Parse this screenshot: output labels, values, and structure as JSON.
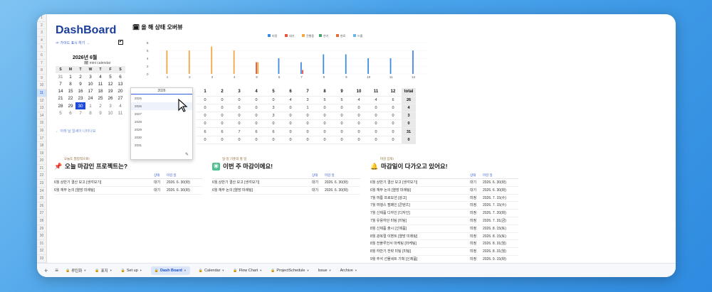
{
  "dashboard": {
    "title": "DashBoard",
    "guide_label": "☞ 가이드 표시 하기 →",
    "guide_checked": "✔"
  },
  "calendar": {
    "month_title": "2026년 6월",
    "mini_label": "🗓 mini calendar",
    "weekday_headers": [
      "S",
      "M",
      "T",
      "W",
      "T",
      "F",
      "S"
    ],
    "weeks": [
      [
        "31",
        "1",
        "2",
        "3",
        "4",
        "5",
        "6"
      ],
      [
        "7",
        "8",
        "9",
        "10",
        "11",
        "12",
        "13"
      ],
      [
        "14",
        "15",
        "16",
        "17",
        "18",
        "19",
        "20"
      ],
      [
        "21",
        "22",
        "23",
        "24",
        "25",
        "26",
        "27"
      ],
      [
        "28",
        "29",
        "30",
        "1",
        "2",
        "3",
        "4"
      ],
      [
        "5",
        "6",
        "7",
        "8",
        "9",
        "10",
        "11"
      ]
    ],
    "today": "30",
    "note": "← 아래 날 일세이 나타나요"
  },
  "chart_data": {
    "type": "bar",
    "title": "올 해 상태 오버뷰",
    "categories": [
      "1",
      "2",
      "3",
      "4",
      "5",
      "6",
      "7",
      "8",
      "9",
      "10",
      "11",
      "12"
    ],
    "ylim": [
      0,
      8
    ],
    "yticks": [
      "0",
      "2",
      "4",
      "6",
      "8"
    ],
    "legend_position": "top",
    "series": [
      {
        "name": "미정",
        "color": "#3f8be0",
        "values": [
          0,
          0,
          0,
          0,
          0,
          4,
          3,
          5,
          5,
          4,
          4,
          6
        ]
      },
      {
        "name": "대기",
        "color": "#e5553a",
        "values": [
          0,
          0,
          0,
          0,
          3,
          0,
          1,
          0,
          0,
          0,
          0,
          0
        ]
      },
      {
        "name": "진행중",
        "color": "#f2a640",
        "values": [
          6,
          6,
          7,
          6,
          3,
          0,
          0,
          0,
          0,
          0,
          0,
          0
        ]
      },
      {
        "name": "연기",
        "color": "#44a368",
        "values": [
          0,
          0,
          0,
          0,
          0,
          0,
          0,
          0,
          0,
          0,
          0,
          0
        ]
      },
      {
        "name": "완료",
        "color": "#e0703a",
        "values": [
          0,
          0,
          0,
          0,
          0,
          0,
          0,
          0,
          0,
          0,
          0,
          0
        ]
      },
      {
        "name": "드롭",
        "color": "#6bb5e8",
        "values": [
          0,
          0,
          0,
          0,
          0,
          0,
          0,
          0,
          0,
          0,
          0,
          0
        ]
      }
    ]
  },
  "year_table": {
    "selected_year": "2026",
    "year_options": [
      "2025",
      "2026",
      "2027",
      "2028",
      "2029",
      "2030",
      "2031"
    ],
    "months": [
      "1",
      "2",
      "3",
      "4",
      "5",
      "6",
      "7",
      "8",
      "9",
      "10",
      "11",
      "12"
    ],
    "total_label": "total",
    "rows": [
      {
        "values": [
          "0",
          "0",
          "0",
          "0",
          "0",
          "4",
          "3",
          "5",
          "5",
          "4",
          "4",
          "6"
        ],
        "total": "26"
      },
      {
        "values": [
          "0",
          "0",
          "0",
          "0",
          "3",
          "0",
          "1",
          "0",
          "0",
          "0",
          "0",
          "0"
        ],
        "total": "4"
      },
      {
        "values": [
          "0",
          "0",
          "0",
          "0",
          "3",
          "0",
          "0",
          "0",
          "0",
          "0",
          "0",
          "0"
        ],
        "total": "3"
      },
      {
        "values": [
          "0",
          "0",
          "0",
          "0",
          "0",
          "0",
          "0",
          "0",
          "0",
          "0",
          "0",
          "0"
        ],
        "total": "0"
      },
      {
        "values": [
          "6",
          "6",
          "7",
          "6",
          "6",
          "0",
          "0",
          "0",
          "0",
          "0",
          "0",
          "0"
        ],
        "total": "31"
      },
      {
        "values": [
          "0",
          "0",
          "0",
          "0",
          "0",
          "0",
          "0",
          "0",
          "0",
          "0",
          "0",
          "0"
        ],
        "total": "0"
      }
    ]
  },
  "sections": {
    "today": {
      "small": "오늘도 열정적으로!",
      "title": "오늘 마감인 프로젝트는?",
      "col_status": "상태",
      "col_deadline": "마감 일",
      "items": [
        {
          "name": "6월 상반기 결산 보고 [생각보기]",
          "status": "대기",
          "date": "2026. 6. 30(화)"
        },
        {
          "name": "6월 재무 논의 [열망 미례팅]",
          "status": "대기",
          "date": "2026. 6. 30(화)"
        }
      ]
    },
    "week": {
      "small": "일-일 기준의 할 일",
      "title": "이번 주 마감이에요!",
      "col_status": "상태",
      "col_deadline": "마감 일",
      "items": [
        {
          "name": "6월 상반기 결산 보고 [생각보기]",
          "status": "대기",
          "date": "2026. 6. 30(화)"
        },
        {
          "name": "6월 재무 논의 [열망 미례팅]",
          "status": "대기",
          "date": "2026. 6. 30(화)"
        }
      ]
    },
    "upcoming": {
      "small": "마감 임박!",
      "title": "마감일이 다가오고 있어요!",
      "col_status": "상태",
      "col_deadline": "마감 일",
      "items": [
        {
          "name": "6월 상반기 결산 보고 [생각보기]",
          "status": "대기",
          "date": "2026. 6. 30(화)"
        },
        {
          "name": "6월 재무 논의 [열망 미례팅]",
          "status": "대기",
          "date": "2026. 6. 30(화)"
        },
        {
          "name": "7월 여름 프로모션 [광고]",
          "status": "미정",
          "date": "2026. 7. 15(수)"
        },
        {
          "name": "7월 여행스 캠페인 [콘텐츠]",
          "status": "미정",
          "date": "2026. 7. 15(수)"
        },
        {
          "name": "7월 신제품 디자인 [디자인]",
          "status": "미정",
          "date": "2026. 7. 20(화)"
        },
        {
          "name": "7월 유용하던 미팅 [미팅]",
          "status": "미정",
          "date": "2026. 7. 31(금)"
        },
        {
          "name": "8월 신제품 출시 [신제품]",
          "status": "미정",
          "date": "2026. 8. 15(토)"
        },
        {
          "name": "8월 광복절 이벤트 [열망 미례팅]",
          "status": "미정",
          "date": "2026. 8. 15(토)"
        },
        {
          "name": "8월 전플루언서 마케팅 [마케팅]",
          "status": "미정",
          "date": "2026. 8. 31(월)"
        },
        {
          "name": "8월 하반기 전략 미팅 [미팅]",
          "status": "미정",
          "date": "2026. 8. 31(월)"
        },
        {
          "name": "9월 추석 선물세트 기획 [신제품]",
          "status": "미정",
          "date": "2026. 9. 15(화)"
        }
      ]
    }
  },
  "tabs": [
    {
      "label": "루틴화",
      "icon": "🔒",
      "active": false
    },
    {
      "label": "표지",
      "icon": "🔒",
      "active": false
    },
    {
      "label": "Set up",
      "icon": "🔒",
      "active": false
    },
    {
      "label": "Dash Board",
      "icon": "🔒",
      "active": true
    },
    {
      "label": "Calendar",
      "icon": "🔒",
      "active": false
    },
    {
      "label": "Flow Chart",
      "icon": "🔒",
      "active": false
    },
    {
      "label": "ProjectSchedule",
      "icon": "🔒",
      "active": false
    },
    {
      "label": "Issue",
      "icon": "",
      "active": false
    },
    {
      "label": "Archive",
      "icon": "",
      "active": false
    }
  ],
  "row_numbers": [
    "1",
    "2",
    "3",
    "4",
    "5",
    "6",
    "7",
    "8",
    "9",
    "10",
    "11",
    "12",
    "13",
    "14",
    "15",
    "16",
    "17",
    "18",
    "19",
    "20",
    "21",
    "22",
    "23",
    "24",
    "25",
    "26",
    "27",
    "28",
    "29",
    "30",
    "31",
    "32",
    "33"
  ],
  "selected_row": "11",
  "icons": {
    "add_sheet": "plus-icon",
    "sheet_list": "list-icon",
    "lock": "lock-icon",
    "pin": "pin-icon",
    "sparkle": "sparkle-icon",
    "bell": "bell-icon",
    "calendar": "calendar-icon",
    "pencil": "pencil-icon",
    "cursor": "cursor-icon"
  }
}
